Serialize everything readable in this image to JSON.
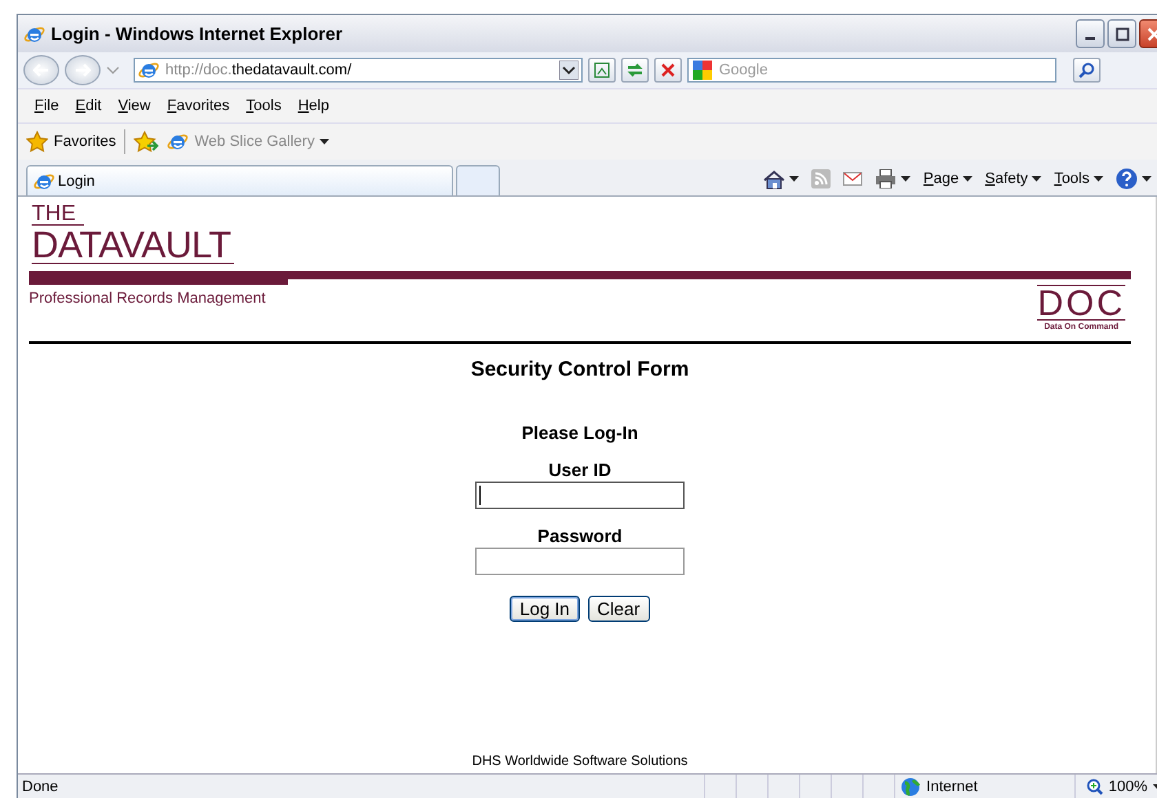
{
  "window": {
    "title": "Login - Windows Internet Explorer"
  },
  "address_bar": {
    "url_prefix": "http://doc.",
    "url_domain": "thedatavault.com/"
  },
  "search": {
    "placeholder": "Google"
  },
  "menu": [
    "File",
    "Edit",
    "View",
    "Favorites",
    "Tools",
    "Help"
  ],
  "favorites_bar": {
    "favorites": "Favorites",
    "items": [
      "Web Slice Gallery"
    ]
  },
  "tabs": [
    {
      "label": "Login",
      "selected": true
    }
  ],
  "command_bar": [
    "Page",
    "Safety",
    "Tools"
  ],
  "page": {
    "logo_top": "THE",
    "logo_main": "DATAVAULT",
    "tagline": "Professional Records Management",
    "doc_logo": "DOC",
    "doc_caption": "Data On Command",
    "title": "Security Control Form",
    "subtitle": "Please Log-In",
    "fields": [
      {
        "label": "User ID",
        "focused": true
      },
      {
        "label": "Password",
        "focused": false
      }
    ],
    "buttons": [
      "Log In",
      "Clear"
    ],
    "footer": "DHS Worldwide Software Solutions"
  },
  "status_bar": {
    "status": "Done",
    "zone": "Internet",
    "zoom": "100%"
  }
}
